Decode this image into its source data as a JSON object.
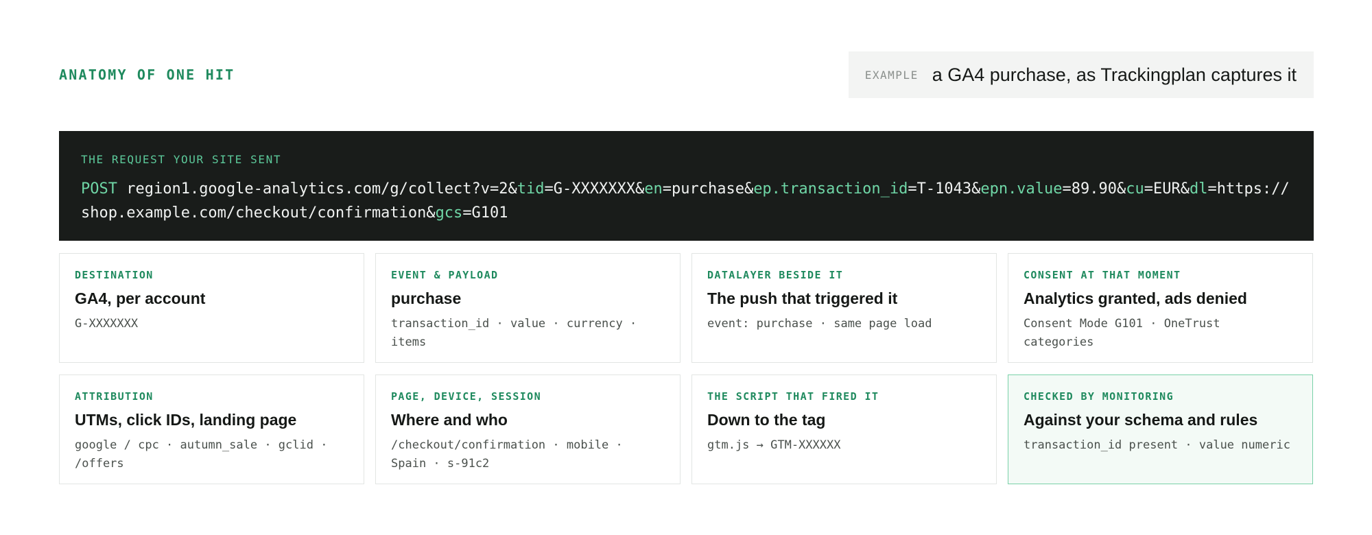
{
  "header": {
    "section_label": "ANATOMY OF ONE HIT",
    "example_tag": "EXAMPLE",
    "example_text": "a GA4 purchase, as Trackingplan captures it"
  },
  "request": {
    "label": "THE REQUEST YOUR SITE SENT",
    "method": "POST",
    "segments": [
      {
        "text": " region1.google-analytics.com/g/collect?v=2&",
        "key": false
      },
      {
        "text": "tid",
        "key": true
      },
      {
        "text": "=G-XXXXXXX&",
        "key": false
      },
      {
        "text": "en",
        "key": true
      },
      {
        "text": "=purchase&",
        "key": false
      },
      {
        "text": "ep.transaction_id",
        "key": true
      },
      {
        "text": "=T-1043&",
        "key": false
      },
      {
        "text": "epn.value",
        "key": true
      },
      {
        "text": "=89.90&",
        "key": false
      },
      {
        "text": "cu",
        "key": true
      },
      {
        "text": "=EUR&",
        "key": false
      },
      {
        "text": "dl",
        "key": true
      },
      {
        "text": "=https://shop.example.com/checkout/confirmation&",
        "key": false
      },
      {
        "text": "gcs",
        "key": true
      },
      {
        "text": "=G101",
        "key": false
      }
    ]
  },
  "cards": [
    {
      "id": "destination",
      "eyebrow": "DESTINATION",
      "title": "GA4, per account",
      "detail": "G-XXXXXXX",
      "highlight": false
    },
    {
      "id": "event-payload",
      "eyebrow": "EVENT & PAYLOAD",
      "title": "purchase",
      "detail": "transaction_id · value · currency · items",
      "highlight": false
    },
    {
      "id": "datalayer",
      "eyebrow": "DATALAYER BESIDE IT",
      "title": "The push that triggered it",
      "detail": "event: purchase · same page load",
      "highlight": false
    },
    {
      "id": "consent",
      "eyebrow": "CONSENT AT THAT MOMENT",
      "title": "Analytics granted, ads denied",
      "detail": "Consent Mode G101 · OneTrust categories",
      "highlight": false
    },
    {
      "id": "attribution",
      "eyebrow": "ATTRIBUTION",
      "title": "UTMs, click IDs, landing page",
      "detail": "google / cpc · autumn_sale · gclid · /offers",
      "highlight": false
    },
    {
      "id": "page-device-session",
      "eyebrow": "PAGE, DEVICE, SESSION",
      "title": "Where and who",
      "detail": "/checkout/confirmation · mobile · Spain · s-91c2",
      "highlight": false
    },
    {
      "id": "script",
      "eyebrow": "THE SCRIPT THAT FIRED IT",
      "title": "Down to the tag",
      "detail": "gtm.js → GTM-XXXXXX",
      "highlight": false
    },
    {
      "id": "monitoring",
      "eyebrow": "CHECKED BY MONITORING",
      "title": "Against your schema and rules",
      "detail": "transaction_id present · value numeric",
      "highlight": true
    }
  ]
}
